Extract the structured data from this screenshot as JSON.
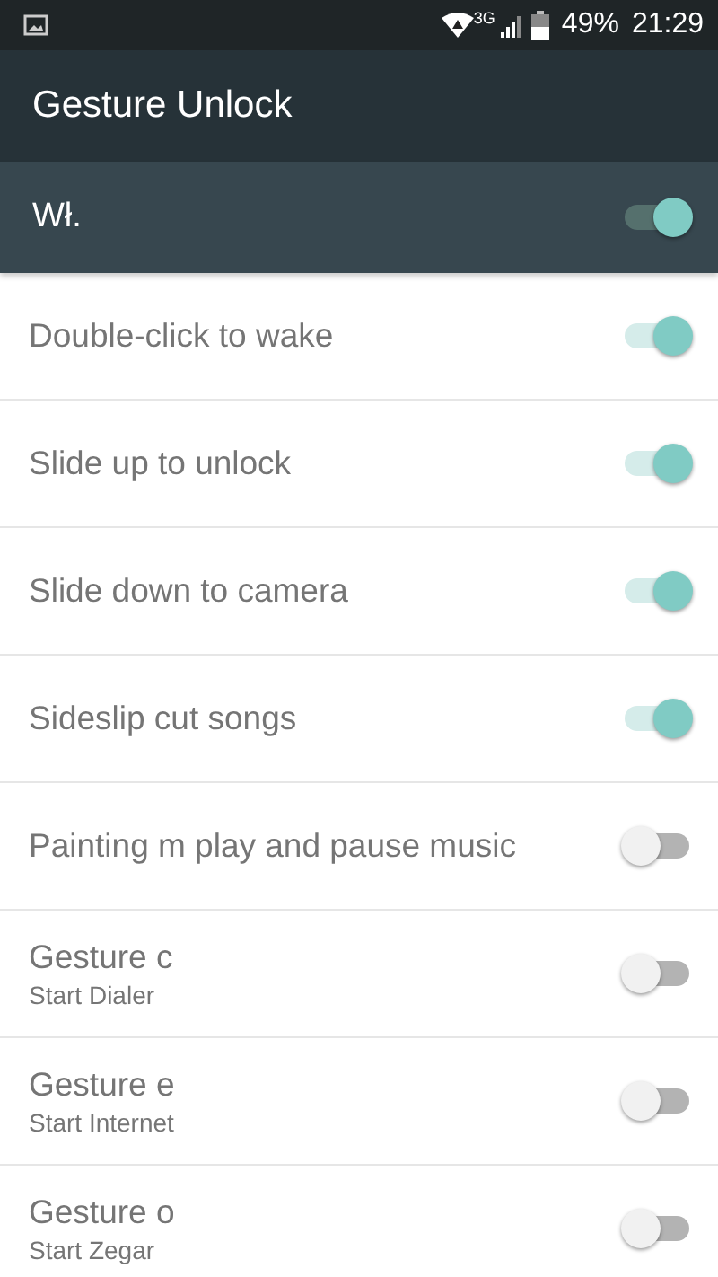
{
  "status_bar": {
    "network": "3G",
    "battery": "49%",
    "time": "21:29"
  },
  "toolbar": {
    "title": "Gesture Unlock"
  },
  "master": {
    "label": "Wł.",
    "on": true
  },
  "settings": [
    {
      "title": "Double-click to wake",
      "on": true
    },
    {
      "title": "Slide up to unlock",
      "on": true
    },
    {
      "title": "Slide down to camera",
      "on": true
    },
    {
      "title": "Sideslip cut songs",
      "on": true
    },
    {
      "title": "Painting m play and pause music",
      "on": false
    },
    {
      "title": "Gesture c",
      "summary": "Start Dialer",
      "on": false
    },
    {
      "title": "Gesture e",
      "summary": "Start Internet",
      "on": false
    },
    {
      "title": "Gesture o",
      "summary": "Start Zegar",
      "on": false
    }
  ]
}
